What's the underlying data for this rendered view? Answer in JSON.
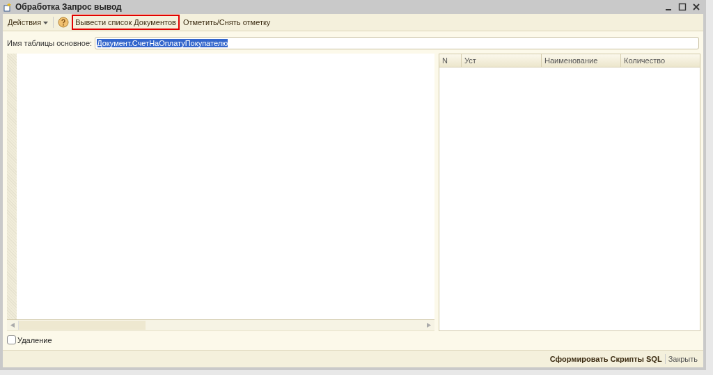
{
  "window": {
    "title": "Обработка  Запрос вывод"
  },
  "toolbar": {
    "items": [
      {
        "kind": "menu",
        "label": "Действия",
        "highlighted": false
      },
      {
        "kind": "help",
        "highlighted": false
      },
      {
        "kind": "button",
        "label": "Вывести список Документов",
        "highlighted": true
      },
      {
        "kind": "button",
        "label": "Отметить/Снять отметку",
        "highlighted": false
      }
    ]
  },
  "table_name_field": {
    "label": "Имя таблицы основное:",
    "value": "Документ.СчетНаОплатуПокупателю",
    "text_selected": true
  },
  "table": {
    "columns": [
      "N",
      "Уст",
      "Наименование",
      "Количество"
    ]
  },
  "delete_checkbox": {
    "label": "Удаление",
    "checked": false
  },
  "footer": {
    "buttons": [
      {
        "label": "Сформировать Скрипты SQL",
        "primary": true
      },
      {
        "label": "Закрыть",
        "primary": false
      }
    ]
  }
}
